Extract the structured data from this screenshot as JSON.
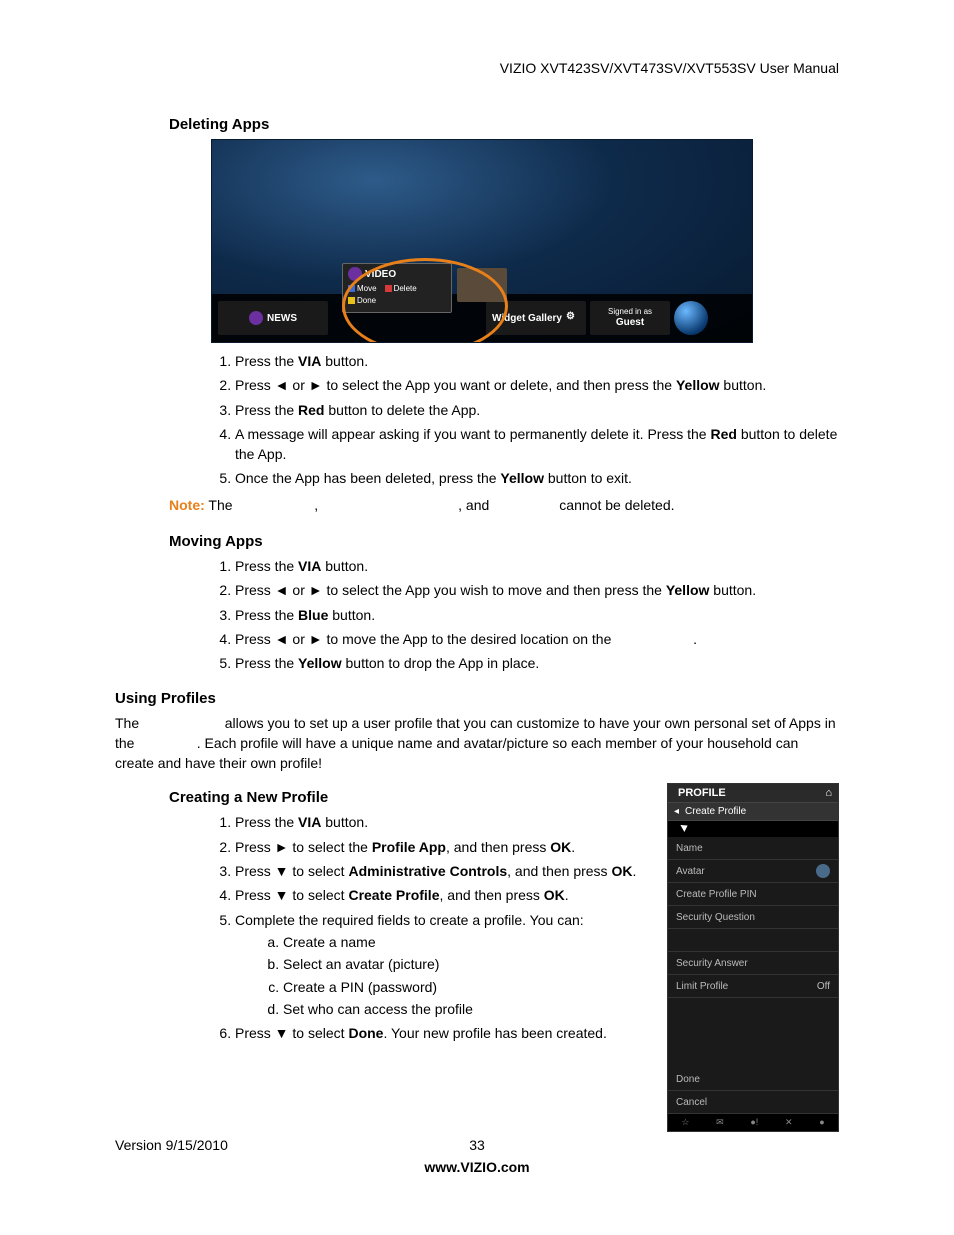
{
  "header": "VIZIO XVT423SV/XVT473SV/XVT553SV User Manual",
  "s1_heading": "Deleting Apps",
  "shot1": {
    "news": "NEWS",
    "video": "VIDEO",
    "move": "Move",
    "delete": "Delete",
    "done": "Done",
    "gallery": "Widget Gallery",
    "signed": "Signed in as",
    "guest": "Guest"
  },
  "s1_steps": {
    "a_pre": "Press the ",
    "a_b": "VIA",
    "a_post": " button.",
    "b_pre": "Press ◄ or ► to select the App you want or delete, and then press the ",
    "b_b": "Yellow",
    "b_post": " button.",
    "c_pre": "Press the ",
    "c_b": "Red",
    "c_post": " button to delete the App.",
    "d_pre": "A message will appear asking if you want to permanently delete it. Press the ",
    "d_b": "Red",
    "d_post": " button to delete the App.",
    "e_pre": "Once the App has been deleted, press the ",
    "e_b": "Yellow",
    "e_post": " button to exit."
  },
  "note": {
    "label": "Note:",
    "t1": " The ",
    "t2": ", ",
    "t3": ", and ",
    "t4": " cannot be deleted."
  },
  "s2_heading": "Moving Apps",
  "s2_steps": {
    "a_pre": "Press the ",
    "a_b": "VIA",
    "a_post": " button.",
    "b_pre": "Press ◄ or ► to select the App you wish to move and then press the ",
    "b_b": "Yellow",
    "b_post": " button.",
    "c_pre": "Press the ",
    "c_b": "Blue",
    "c_post": " button.",
    "d_pre": "Press  ◄ or  ► to move the App to the desired location on the ",
    "d_post": ".",
    "e_pre": "Press the ",
    "e_b": "Yellow",
    "e_post": " button to drop the App in place."
  },
  "s3_heading": "Using Profiles",
  "s3_body": {
    "p1": "The ",
    "p2": " allows you to set up a user profile that you can customize to have your own personal set of Apps in the ",
    "p3": ". Each profile will have a unique name and avatar/picture so each member of your household can create and have their own profile!"
  },
  "s4_heading": "Creating a New Profile",
  "s4_steps": {
    "a_pre": "Press the ",
    "a_b": "VIA",
    "a_post": " button.",
    "b_pre": "Press ► to select the ",
    "b_b1": "Profile App",
    "b_mid": ", and then press ",
    "b_b2": "OK",
    "b_post": ".",
    "c_pre": "Press ▼ to select ",
    "c_b1": "Administrative Controls",
    "c_mid": ", and then press ",
    "c_b2": "OK",
    "c_post": ".",
    "d_pre": "Press ▼ to select ",
    "d_b1": "Create Profile",
    "d_mid": ", and then press ",
    "d_b2": "OK",
    "d_post": ".",
    "e": "Complete the required fields to create a profile. You can:",
    "e_a": "Create a name",
    "e_b": "Select an avatar (picture)",
    "e_c": "Create a PIN (password)",
    "e_d": "Set who can access the profile",
    "f_pre": "Press ▼ to select ",
    "f_b": "Done",
    "f_post": ". Your new profile has been created."
  },
  "profile": {
    "title": "PROFILE",
    "crumb": "Create Profile",
    "name": "Name",
    "avatar": "Avatar",
    "pin": "Create Profile PIN",
    "secq": "Security Question",
    "seca": "Security Answer",
    "limit": "Limit Profile",
    "off": "Off",
    "done": "Done",
    "cancel": "Cancel"
  },
  "footer": {
    "version": "Version 9/15/2010",
    "page": "33",
    "url": "www.VIZIO.com"
  }
}
